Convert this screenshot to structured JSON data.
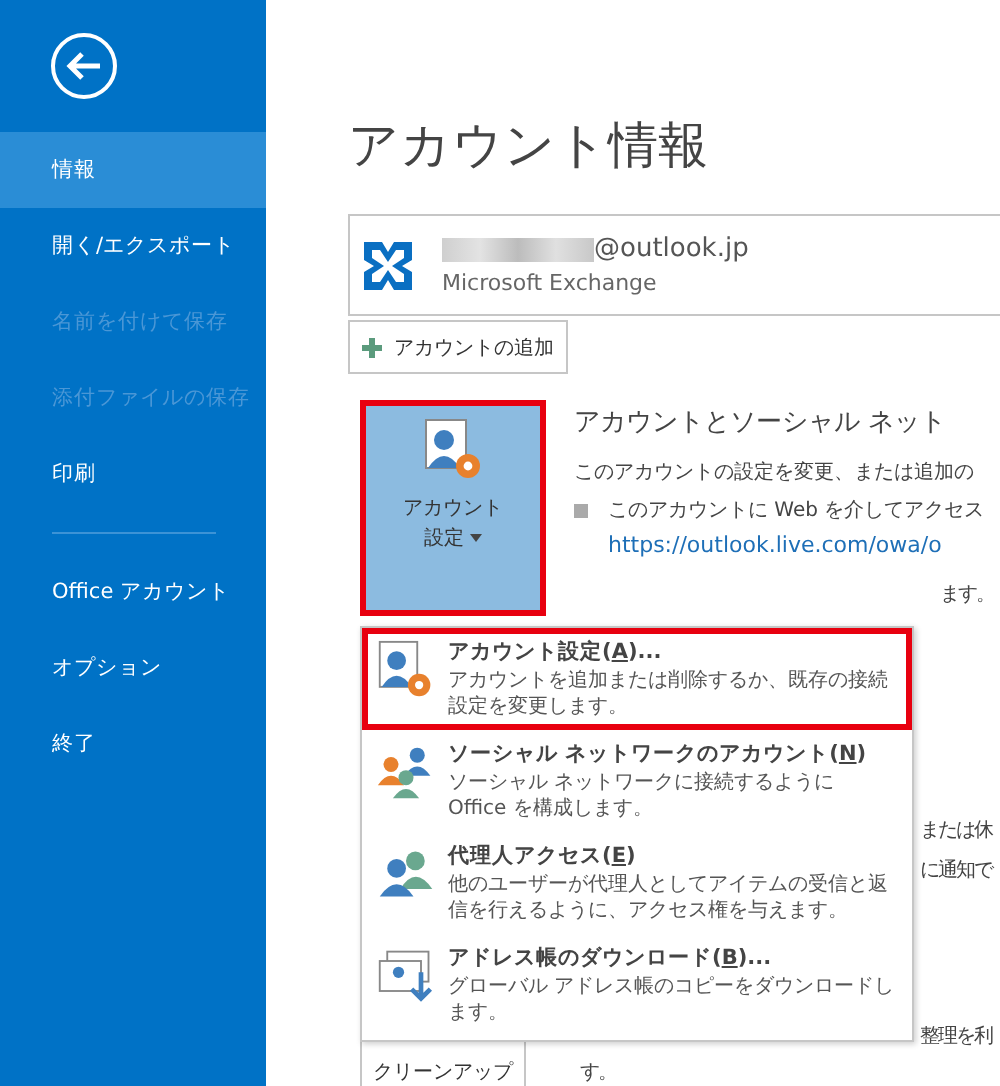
{
  "sidebar": {
    "sections": [
      {
        "items": [
          {
            "label": "情報",
            "selected": true,
            "disabled": false
          },
          {
            "label": "開く/エクスポート",
            "selected": false,
            "disabled": false
          },
          {
            "label": "名前を付けて保存",
            "selected": false,
            "disabled": true
          },
          {
            "label": "添付ファイルの保存",
            "selected": false,
            "disabled": true
          },
          {
            "label": "印刷",
            "selected": false,
            "disabled": false
          }
        ]
      },
      {
        "items": [
          {
            "label": "Office アカウント",
            "selected": false,
            "disabled": false
          },
          {
            "label": "オプション",
            "selected": false,
            "disabled": false
          },
          {
            "label": "終了",
            "selected": false,
            "disabled": false
          }
        ]
      }
    ]
  },
  "page_title": "アカウント情報",
  "account": {
    "email": "@outlook.jp",
    "type": "Microsoft Exchange"
  },
  "add_account_button": "アカウントの追加",
  "account_settings_button": {
    "lines": [
      "アカウント",
      "設定"
    ],
    "highlighted": true
  },
  "section": {
    "title": "アカウントとソーシャル ネット",
    "description": "このアカウントの設定を変更、または追加の",
    "bullet": "このアカウントに Web を介してアクセス",
    "link": "https://outlook.live.com/owa/o",
    "fragments": [
      "ます。",
      "または休",
      "に通知で",
      "整理を利",
      "す。"
    ]
  },
  "cleanup_button": "クリーンアップ",
  "menu": {
    "items": [
      {
        "kind": "settings",
        "title_start": "アカウント設定(",
        "access_key": "A",
        "title_end": ")...",
        "description": "アカウントを追加または削除するか、既存の接続設定を変更します。",
        "highlighted": true
      },
      {
        "kind": "social",
        "title_start": "ソーシャル ネットワークのアカウント(",
        "access_key": "N",
        "title_end": ")",
        "description": "ソーシャル ネットワークに接続するように Office を構成します。",
        "highlighted": false
      },
      {
        "kind": "delegate",
        "title_start": "代理人アクセス(",
        "access_key": "E",
        "title_end": ")",
        "description": "他のユーザーが代理人としてアイテムの受信と返信を行えるように、アクセス権を与えます。",
        "highlighted": false
      },
      {
        "kind": "download",
        "title_start": "アドレス帳のダウンロード(",
        "access_key": "B",
        "title_end": ")...",
        "description": "グローバル アドレス帳のコピーをダウンロードします。",
        "highlighted": false
      }
    ]
  }
}
